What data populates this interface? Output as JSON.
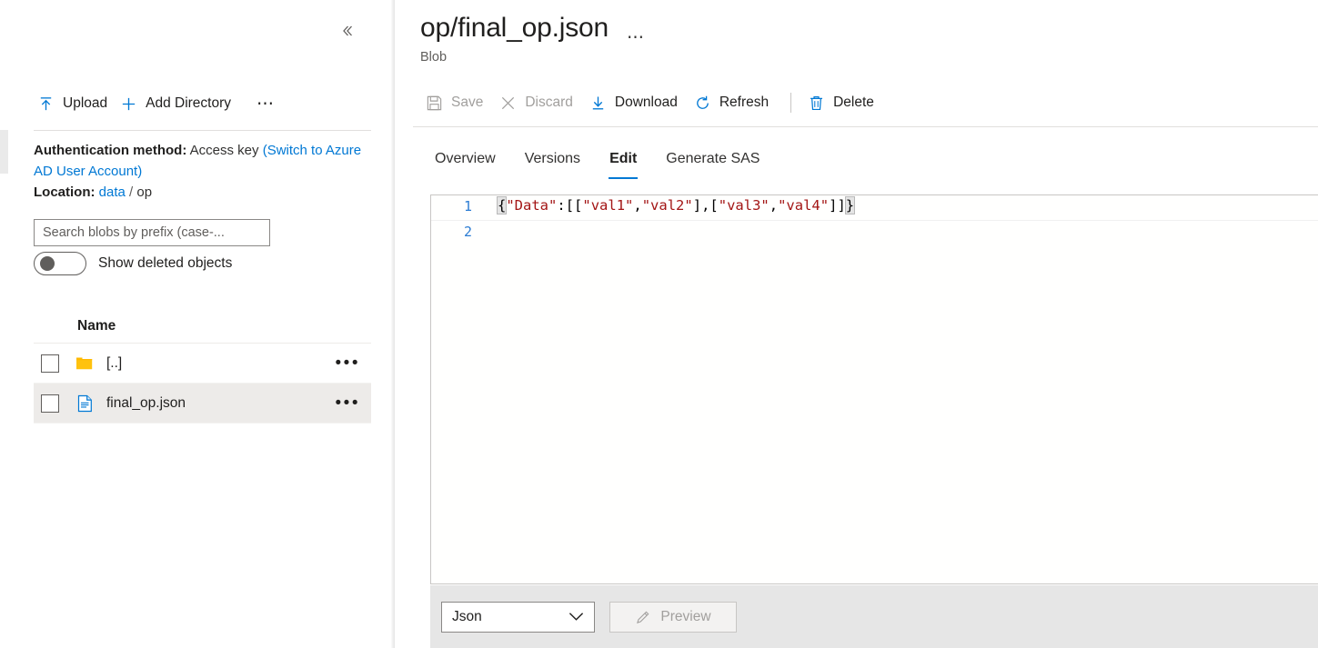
{
  "left_panel": {
    "collapse_icon": "chevron-double-left-icon",
    "toolbar": {
      "upload_label": "Upload",
      "upload_icon": "upload-icon",
      "add_directory_label": "Add Directory",
      "add_directory_icon": "plus-icon",
      "more_label": "⋯"
    },
    "meta": {
      "auth_label": "Authentication method:",
      "auth_value": "Access key",
      "auth_link": "(Switch to Azure AD User Account)",
      "location_label": "Location:",
      "location_link": "data",
      "location_separator": "/",
      "location_current": "op"
    },
    "search": {
      "placeholder": "Search blobs by prefix (case-...",
      "value": ""
    },
    "toggle": {
      "label": "Show deleted objects",
      "state": "off"
    },
    "list": {
      "column_header": "Name",
      "rows": [
        {
          "name": "[..]",
          "icon": "folder-icon",
          "selected": false,
          "menu": "•••"
        },
        {
          "name": "final_op.json",
          "icon": "file-json-icon",
          "selected": true,
          "menu": "•••"
        }
      ]
    }
  },
  "main": {
    "title": "op/final_op.json",
    "title_menu": "⋯",
    "subtitle": "Blob",
    "commands": [
      {
        "label": "Save",
        "icon": "save-icon",
        "disabled": true
      },
      {
        "label": "Discard",
        "icon": "close-icon",
        "disabled": true
      },
      {
        "label": "Download",
        "icon": "download-icon",
        "disabled": false
      },
      {
        "label": "Refresh",
        "icon": "refresh-icon",
        "disabled": false
      },
      {
        "label": "Delete",
        "icon": "trash-icon",
        "disabled": false
      }
    ],
    "tabs": [
      {
        "label": "Overview",
        "active": false
      },
      {
        "label": "Versions",
        "active": false
      },
      {
        "label": "Edit",
        "active": true
      },
      {
        "label": "Generate SAS",
        "active": false
      }
    ],
    "editor": {
      "lines": [
        {
          "number": "1",
          "text": "{\"Data\":[[\"val1\",\"val2\"],[\"val3\",\"val4\"]]}"
        },
        {
          "number": "2",
          "text": ""
        }
      ],
      "tokens_line1": {
        "open_brace": "{",
        "key": "\"Data\"",
        "colon": ":",
        "open_outer": "[",
        "open_inner1": "[",
        "v1": "\"val1\"",
        "c1": ",",
        "v2": "\"val2\"",
        "close_inner1": "]",
        "c2": ",",
        "open_inner2": "[",
        "v3": "\"val3\"",
        "c3": ",",
        "v4": "\"val4\"",
        "close_inner2": "]",
        "close_outer": "]",
        "close_brace": "}"
      }
    },
    "footer": {
      "language_value": "Json",
      "language_chevron": "⌄",
      "preview_label": "Preview",
      "preview_icon": "pencil-icon",
      "preview_disabled": true
    }
  },
  "colors": {
    "accent": "#0078d4",
    "folder": "#ffb900",
    "string_token": "#a31515",
    "line_number": "#2b7cd3",
    "disabled_text": "#a19f9d",
    "footer_bg": "#e6e6e6",
    "selected_row_bg": "#edebe9"
  }
}
